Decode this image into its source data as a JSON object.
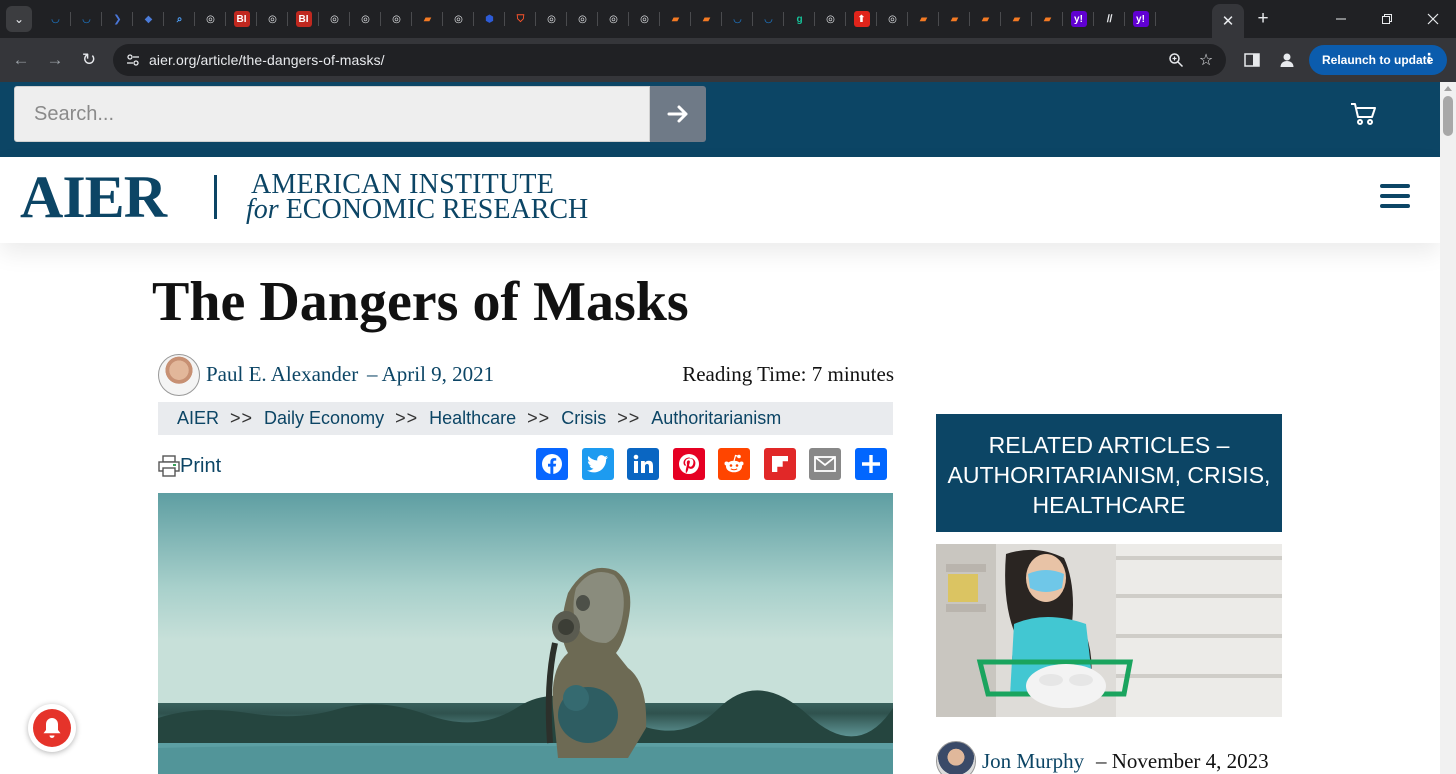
{
  "browser": {
    "tab_favicons": [
      "shield",
      "shield",
      "bookmark",
      "graduation-cap",
      "search",
      "globe",
      "bi",
      "globe",
      "bi",
      "globe",
      "globe",
      "globe",
      "bookmark-orange",
      "globe",
      "hexagon",
      "brave",
      "globe",
      "globe",
      "globe",
      "globe",
      "bookmark-orange",
      "bookmark-orange",
      "shield",
      "shield",
      "grammarly",
      "globe",
      "upvote",
      "globe",
      "bookmark-orange",
      "bookmark-orange",
      "bookmark-orange",
      "bookmark-orange",
      "bookmark-orange",
      "yahoo",
      "italic-text",
      "yahoo"
    ],
    "active_tab_close": "✕",
    "new_tab": "+",
    "url": "aier.org/article/the-dangers-of-masks/",
    "relaunch_label": "Relaunch to update",
    "relaunch_menu": "⋮"
  },
  "site": {
    "search_placeholder": "Search...",
    "logo_mark": "AIER",
    "logo_line1": "AMERICAN INSTITUTE",
    "logo_line2_italic": "for",
    "logo_line2_rest": "ECONOMIC RESEARCH",
    "brand_color": "#0c4565"
  },
  "article": {
    "title": "The Dangers of Masks",
    "author": "Paul E. Alexander",
    "date": "– April 9, 2021",
    "reading_time": "Reading Time: 7 minutes",
    "breadcrumbs": [
      "AIER",
      "Daily Economy",
      "Healthcare",
      "Crisis",
      "Authoritarianism"
    ],
    "breadcrumb_sep": ">>",
    "print_label": "Print",
    "share_buttons": [
      {
        "name": "facebook",
        "color": "#0866ff"
      },
      {
        "name": "twitter",
        "color": "#1d9bf0"
      },
      {
        "name": "linkedin",
        "color": "#0a66c2"
      },
      {
        "name": "pinterest",
        "color": "#e60023"
      },
      {
        "name": "reddit",
        "color": "#ff4500"
      },
      {
        "name": "flipboard",
        "color": "#e12828"
      },
      {
        "name": "email",
        "color": "#888888"
      },
      {
        "name": "share",
        "color": "#0166ff"
      }
    ]
  },
  "sidebar": {
    "related_heading": "RELATED ARTICLES – AUTHORITARIANISM, CRISIS, HEALTHCARE",
    "related_author": "Jon Murphy",
    "related_date": "– November 4, 2023"
  }
}
